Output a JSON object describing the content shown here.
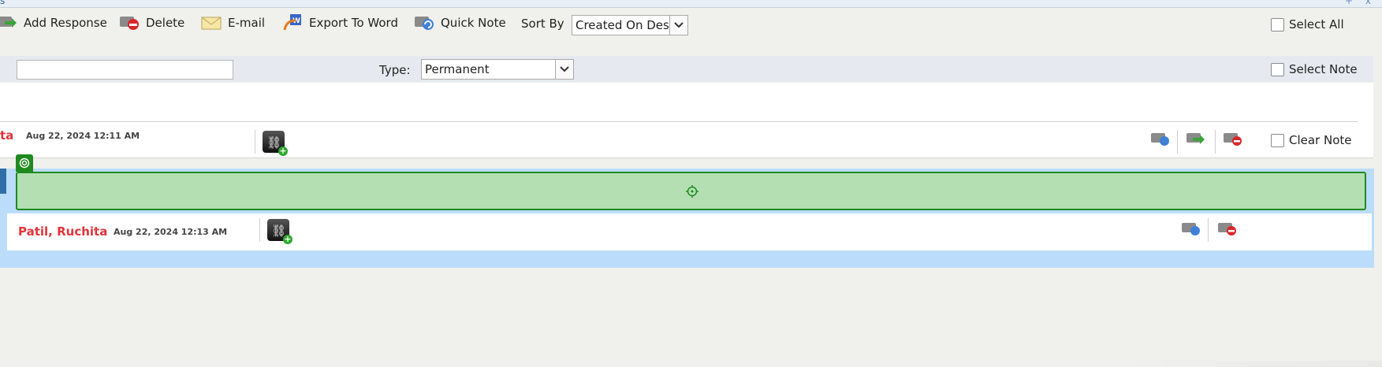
{
  "window": {
    "tab_fragment": "s",
    "controls": "+ x"
  },
  "toolbar": {
    "add_response": "Add Response",
    "delete": "Delete",
    "email": "E-mail",
    "export_word": "Export To Word",
    "quick_note": "Quick Note",
    "sort_by_label": "Sort By",
    "sort_by_value": "Created On Desc",
    "select_all": "Select All"
  },
  "filter": {
    "type_label": "Type:",
    "type_value": "Permanent",
    "select_note": "Select Note",
    "search_value": ""
  },
  "notes": [
    {
      "author": "ta",
      "date": "Aug 22, 2024 12:11 AM",
      "clear_note": "Clear Note"
    },
    {
      "author": "Patil, Ruchita",
      "date": "Aug 22, 2024 12:13 AM"
    }
  ],
  "colors": {
    "author": "#e0353b",
    "highlight_fill": "#b3dfb3",
    "highlight_border": "#1f8a1f",
    "band": "#bcdcfb"
  }
}
